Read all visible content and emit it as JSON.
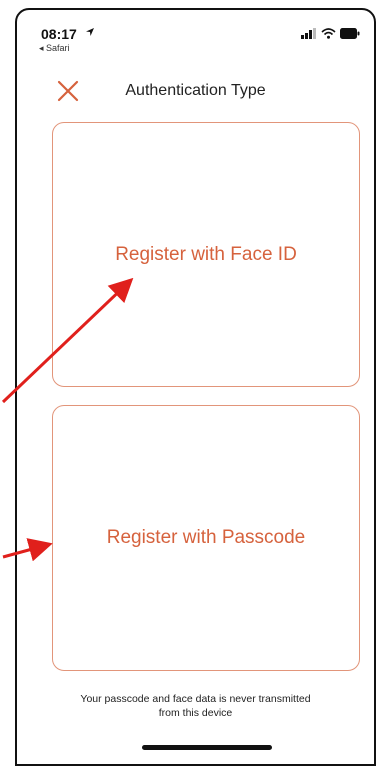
{
  "status": {
    "time": "08:17",
    "back_label": "◂ Safari"
  },
  "nav": {
    "title": "Authentication Type",
    "close_icon": "close-x-icon"
  },
  "options": {
    "face_id_label": "Register with Face ID",
    "passcode_label": "Register with Passcode"
  },
  "footer": {
    "line1": "Your passcode and face data is never transmitted",
    "line2": "from this device"
  },
  "colors": {
    "accent": "#d6623d",
    "card_border": "#e2957a",
    "annotation_arrow": "#e0201c"
  }
}
